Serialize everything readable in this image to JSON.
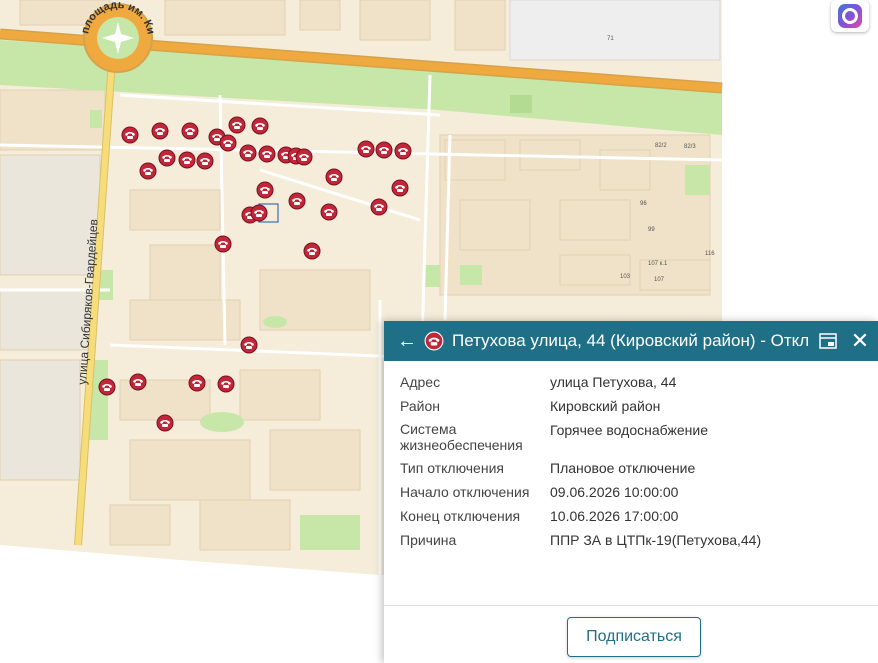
{
  "map": {
    "street_sibiryakov": "улица Сибиряков-Гвардейцев",
    "square_kirov": "площадь им. Кирова",
    "building_numbers": [
      "71",
      "82/2",
      "82/3",
      "96",
      "99",
      "107 к.1",
      "107",
      "103",
      "116"
    ]
  },
  "popup": {
    "title": "Петухова улица, 44 (Кировский район) - Откл",
    "rows": [
      {
        "label": "Адрес",
        "value": "улица Петухова, 44"
      },
      {
        "label": "Район",
        "value": "Кировский район"
      },
      {
        "label": "Система жизнеобеспечения",
        "value": "Горячее водоснабжение"
      },
      {
        "label": "Тип отключения",
        "value": "Плановое отключение"
      },
      {
        "label": "Начало отключения",
        "value": "09.06.2026 10:00:00"
      },
      {
        "label": "Конец отключения",
        "value": "10.06.2026 17:00:00"
      },
      {
        "label": "Причина",
        "value": "ППР ЗА в ЦТПк-19(Петухова,44)"
      }
    ],
    "subscribe_label": "Подписаться"
  },
  "colors": {
    "header": "#1f6f87",
    "marker": "#c0283a",
    "main_road": "#f0a93e",
    "secondary_road": "#f6dd7a",
    "park": "#c7e7a8",
    "block": "#f5ecd9",
    "building": "#efe2c8"
  },
  "icons": [
    "back-arrow-icon",
    "outage-phone-icon",
    "dock-icon",
    "close-icon",
    "app-logo-icon"
  ]
}
